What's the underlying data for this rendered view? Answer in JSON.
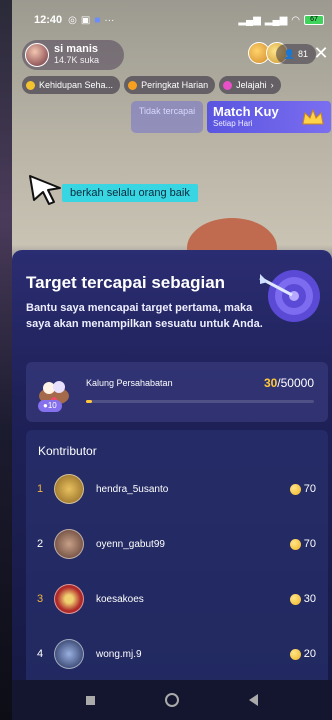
{
  "status": {
    "time": "12:40",
    "battery": "67"
  },
  "host": {
    "name": "si manis",
    "likes": "14.7K suka"
  },
  "viewers": {
    "count": "81"
  },
  "chips": [
    {
      "label": "Kehidupan Seha...",
      "color": "#f2c230"
    },
    {
      "label": "Peringkat Harian",
      "color": "#f7a020"
    },
    {
      "label": "Jelajahi",
      "color": "#e850c8"
    }
  ],
  "match": {
    "not_achieved": "Tidak tercapai",
    "title": "Match Kuy",
    "subtitle": "Setiap Hari"
  },
  "caption": "berkah selalu orang baik",
  "target": {
    "title": "Target tercapai sebagian",
    "description": "Bantu saya mencapai target pertama, maka saya akan menampilkan sesuatu untuk Anda.",
    "gift_name": "Kalung Persahabatan",
    "level": "10",
    "current": "30",
    "goal": "/50000",
    "progress_fraction": 0.0006
  },
  "contributors": {
    "title": "Kontributor",
    "rows": [
      {
        "rank": "1",
        "name": "hendra_5usanto",
        "coins": "70",
        "gold": true,
        "avatar": "#c49a3a"
      },
      {
        "rank": "2",
        "name": "oyenn_gabut99",
        "coins": "70",
        "gold": false,
        "avatar": "#7a5a4a"
      },
      {
        "rank": "3",
        "name": "koesakoes",
        "coins": "30",
        "gold": true,
        "avatar": "#b02a2a"
      },
      {
        "rank": "4",
        "name": "wong.mj.9",
        "coins": "20",
        "gold": false,
        "avatar": "#2b3f74"
      }
    ]
  },
  "colors": {
    "accent": "#ffc83a",
    "sheet": "#1e2158",
    "caption_bg": "#37d6e2"
  }
}
